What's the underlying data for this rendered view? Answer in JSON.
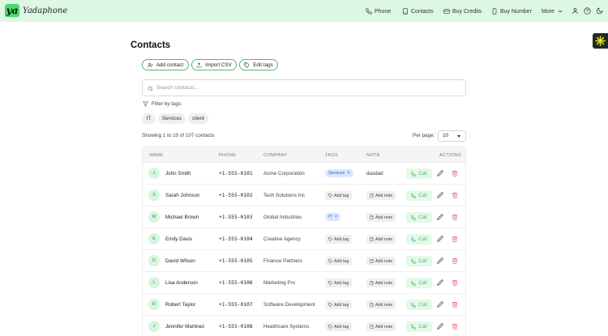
{
  "brand": {
    "badge": "ya",
    "name": "Yadaphone"
  },
  "nav": {
    "items": [
      {
        "label": "Phone",
        "icon": "phone-icon"
      },
      {
        "label": "Contacts",
        "icon": "contacts-book-icon"
      },
      {
        "label": "Buy Credits",
        "icon": "credit-card-icon"
      },
      {
        "label": "Buy Number",
        "icon": "mobile-device-icon"
      },
      {
        "label": "More",
        "icon": "chevron-down-icon"
      }
    ],
    "right_icons": [
      "user-icon",
      "help-icon",
      "dark-mode-moon-icon"
    ]
  },
  "page": {
    "title": "Contacts"
  },
  "actions": {
    "add_contact": "Add contact",
    "import_csv": "Import CSV",
    "edit_tags": "Edit tags"
  },
  "search": {
    "placeholder": "Search contacts..."
  },
  "filter": {
    "label": "Filter by tags:",
    "tags": [
      "IT",
      "Services",
      "client"
    ]
  },
  "summary": {
    "showing": "Showing 1 to 10 of 107 contacts",
    "per_page_label": "Per page:",
    "per_page_value": "10"
  },
  "table": {
    "headers": {
      "name": "NAME",
      "phone": "PHONE",
      "company": "COMPANY",
      "tags": "TAGS",
      "note": "NOTE",
      "actions": "ACTIONS"
    },
    "add_tag_label": "Add tag",
    "add_note_label": "Add note",
    "call_label": "Call",
    "rows": [
      {
        "initial": "J",
        "name": "John Smith",
        "phone": "+1-555-0101",
        "company": "Acme Corporation",
        "tag": "Services",
        "note": "dasdad"
      },
      {
        "initial": "S",
        "name": "Sarah Johnson",
        "phone": "+1-555-0102",
        "company": "Tech Solutions Inc",
        "tag": "",
        "note": ""
      },
      {
        "initial": "M",
        "name": "Michael Brown",
        "phone": "+1-555-0103",
        "company": "Global Industries",
        "tag": "IT",
        "note": ""
      },
      {
        "initial": "E",
        "name": "Emily Davis",
        "phone": "+1-555-0104",
        "company": "Creative Agency",
        "tag": "",
        "note": ""
      },
      {
        "initial": "D",
        "name": "David Wilson",
        "phone": "+1-555-0105",
        "company": "Finance Partners",
        "tag": "",
        "note": ""
      },
      {
        "initial": "L",
        "name": "Lisa Anderson",
        "phone": "+1-555-0106",
        "company": "Marketing Pro",
        "tag": "",
        "note": ""
      },
      {
        "initial": "R",
        "name": "Robert Taylor",
        "phone": "+1-555-0107",
        "company": "Software Development",
        "tag": "",
        "note": ""
      },
      {
        "initial": "J",
        "name": "Jennifer Martinez",
        "phone": "+1-555-0108",
        "company": "Healthcare Systems",
        "tag": "",
        "note": ""
      }
    ]
  },
  "colors": {
    "accent": "#4bbf6a",
    "header_bg": "#dcf7e3",
    "tag_blue": "#3159c9",
    "danger": "#e5484d"
  }
}
